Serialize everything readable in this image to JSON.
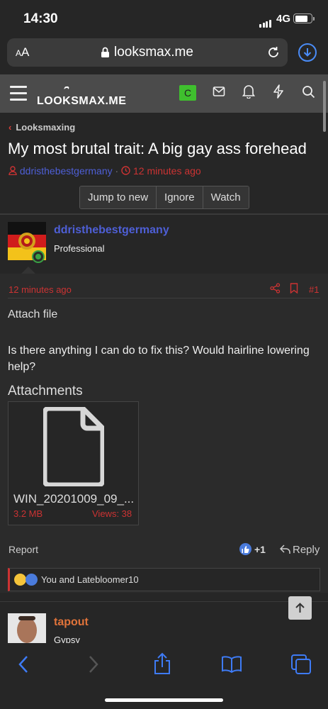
{
  "status": {
    "time": "14:30",
    "network": "4G",
    "battery_level": 0.8
  },
  "browser": {
    "text_size_label_small": "A",
    "text_size_label_large": "A",
    "url": "looksmax.me"
  },
  "site": {
    "logo_text": "LOOKSMAX.ME",
    "badge": "C"
  },
  "thread": {
    "breadcrumb": "Looksmaxing",
    "title": "My most brutal trait: A big gay ass forehead",
    "author": "ddristhebestgermany",
    "separator": "·",
    "time": "12 minutes ago",
    "buttons": [
      "Jump to new",
      "Ignore",
      "Watch"
    ]
  },
  "post": {
    "username": "ddristhebestgermany",
    "role": "Professional",
    "time": "12 minutes ago",
    "number": "#1",
    "attach_label": "Attach file",
    "body": "Is there anything I can do to fix this? Would hairline lowering help?",
    "attachments_heading": "Attachments",
    "attachment": {
      "name": "WIN_20201009_09_...",
      "size": "3.2 MB",
      "views": "Views: 38"
    },
    "report_label": "Report",
    "like_count": "+1",
    "reply_label": "Reply",
    "reactions_text": "You and Latebloomer10"
  },
  "next_post": {
    "username": "tapout",
    "role": "Gypsy"
  },
  "colors": {
    "accent": "#c33333",
    "username": "#4e5fd6",
    "link_blue": "#3e7bf5",
    "badge_green": "#3fbf2e"
  }
}
